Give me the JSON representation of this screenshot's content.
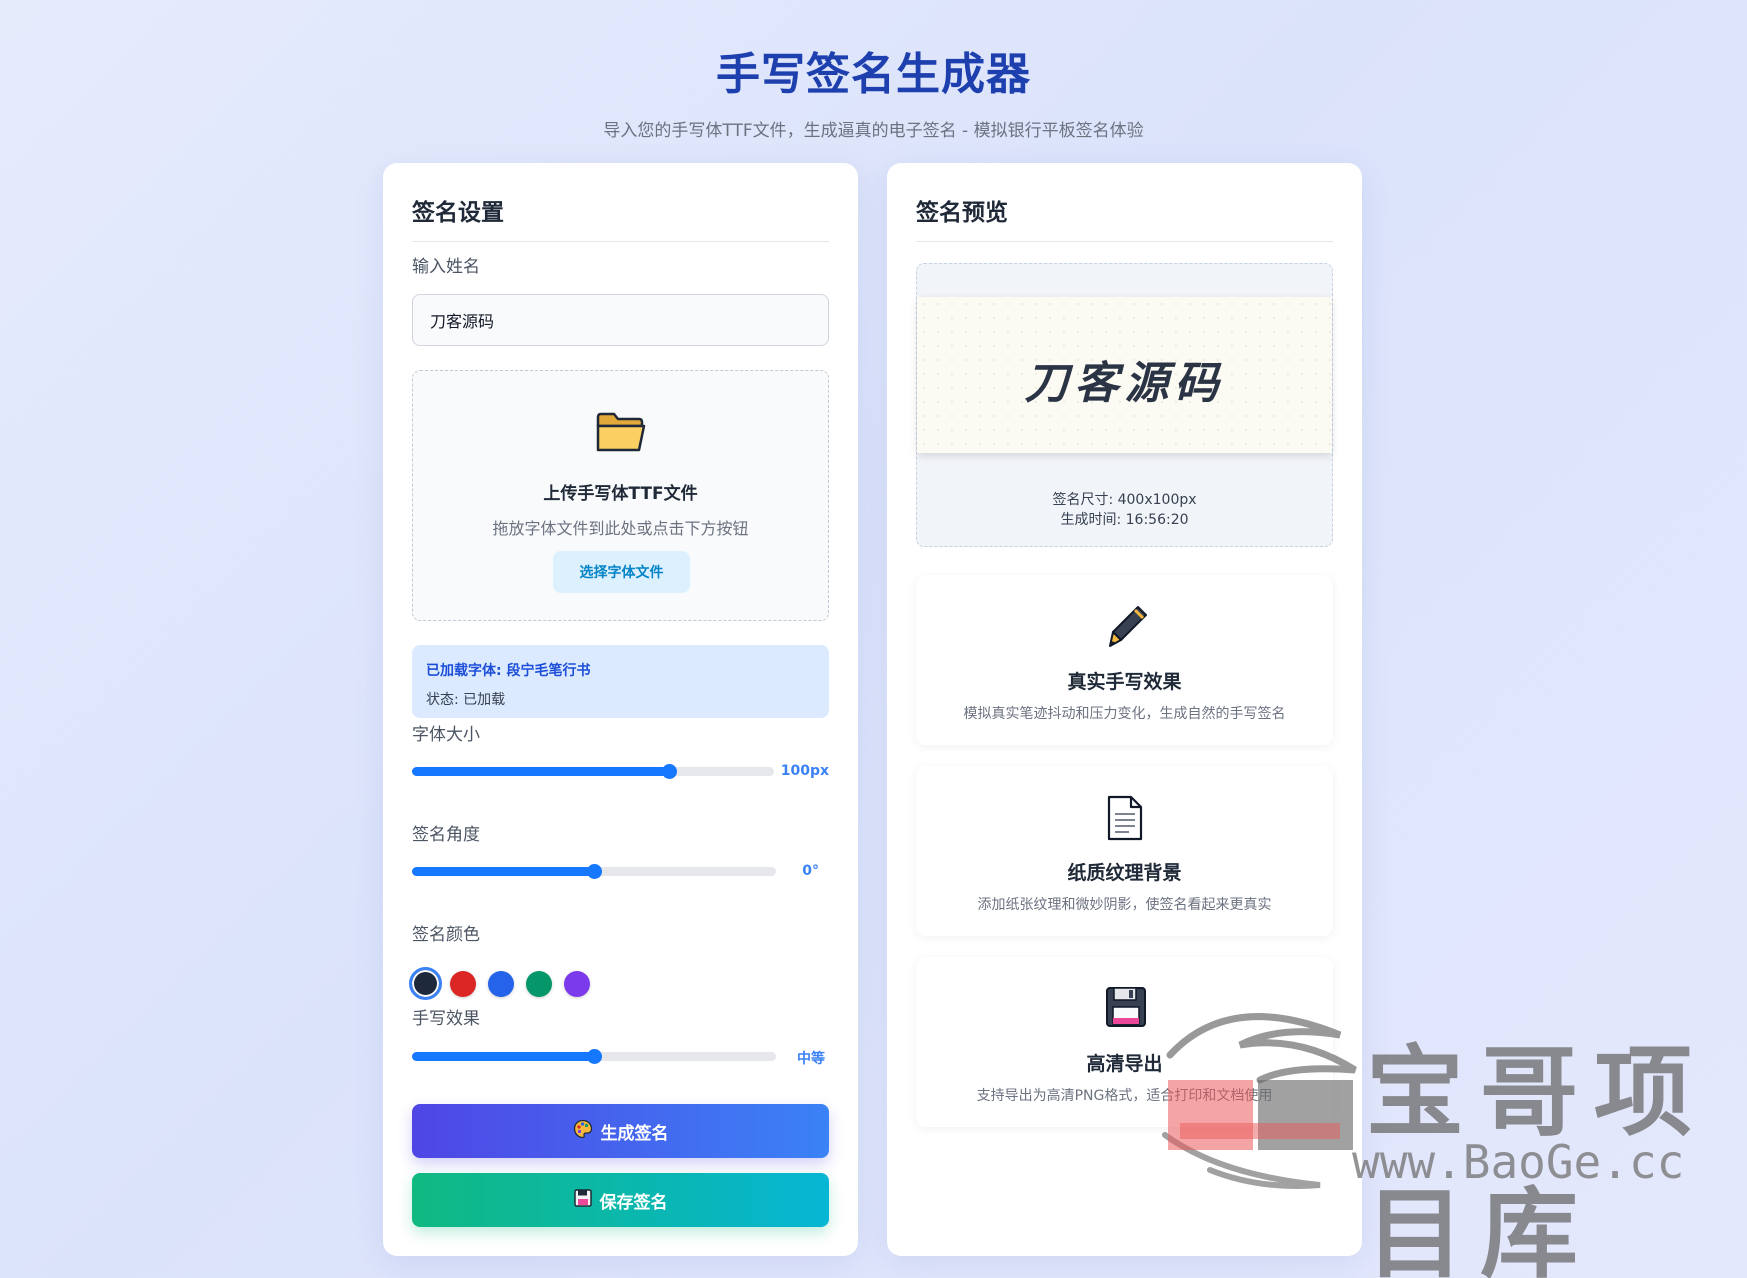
{
  "header": {
    "title": "手写签名生成器",
    "subtitle": "导入您的手写体TTF文件，生成逼真的电子签名 - 模拟银行平板签名体验"
  },
  "settings": {
    "title": "签名设置",
    "name_label": "输入姓名",
    "name_value": "刀客源码",
    "upload": {
      "icon": "folder-icon",
      "title": "上传手写体TTF文件",
      "hint": "拖放字体文件到此处或点击下方按钮",
      "button": "选择字体文件"
    },
    "font_status": {
      "loaded": "已加载字体: 段宁毛笔行书",
      "state": "状态: 已加载"
    },
    "font_size": {
      "label": "字体大小",
      "value": "100px",
      "fraction": 0.71
    },
    "angle": {
      "label": "签名角度",
      "value": "0°",
      "fraction": 0.5
    },
    "color": {
      "label": "签名颜色",
      "swatches": [
        "#1e293b",
        "#dc2626",
        "#2563eb",
        "#059669",
        "#7c3aed"
      ],
      "selected": 0
    },
    "effect": {
      "label": "手写效果",
      "value": "中等",
      "fraction": 0.5
    },
    "generate_button": "生成签名",
    "save_button": "保存签名"
  },
  "preview": {
    "title": "签名预览",
    "signature": "刀客源码",
    "size_text": "签名尺寸: 400x100px",
    "time_text": "生成时间: 16:56:20"
  },
  "features": [
    {
      "icon": "pen-icon",
      "title": "真实手写效果",
      "desc": "模拟真实笔迹抖动和压力变化，生成自然的手写签名"
    },
    {
      "icon": "document-icon",
      "title": "纸质纹理背景",
      "desc": "添加纸张纹理和微妙阴影，使签名看起来更真实"
    },
    {
      "icon": "floppy-icon",
      "title": "高清导出",
      "desc": "支持导出为高清PNG格式，适合打印和文档使用"
    }
  ],
  "watermark": {
    "text": "宝哥项目库",
    "url": "www.BaoGe.cc"
  }
}
